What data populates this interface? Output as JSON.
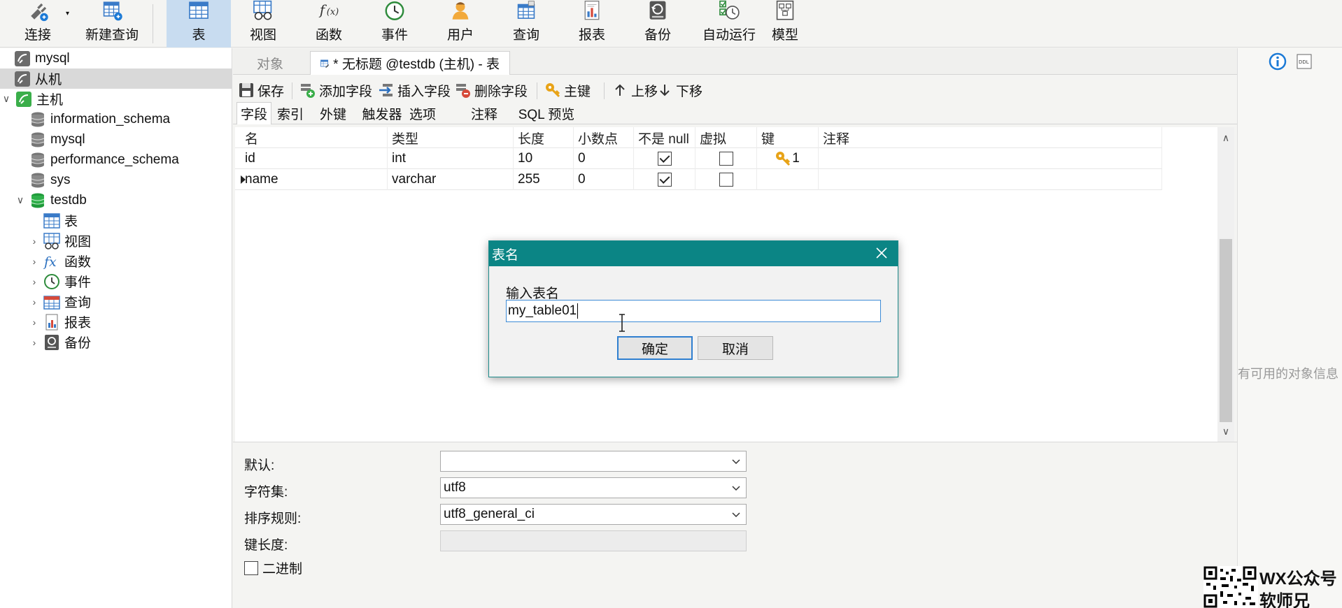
{
  "toolbar": {
    "items": [
      {
        "label": "连接",
        "icon": "plug-connect-icon"
      },
      {
        "label": "新建查询",
        "icon": "new-query-icon"
      },
      {
        "label": "表",
        "icon": "table-icon",
        "active": true
      },
      {
        "label": "视图",
        "icon": "view-glasses-icon"
      },
      {
        "label": "函数",
        "icon": "function-fx-icon"
      },
      {
        "label": "事件",
        "icon": "event-clock-icon"
      },
      {
        "label": "用户",
        "icon": "user-icon"
      },
      {
        "label": "查询",
        "icon": "query-icon"
      },
      {
        "label": "报表",
        "icon": "report-icon"
      },
      {
        "label": "备份",
        "icon": "backup-icon"
      },
      {
        "label": "自动运行",
        "icon": "auto-run-icon"
      },
      {
        "label": "模型",
        "icon": "model-icon"
      }
    ]
  },
  "tree": {
    "items": [
      {
        "label": "mysql",
        "level": 0,
        "icon": "connection-icon"
      },
      {
        "label": "从机",
        "level": 0,
        "icon": "connection-icon",
        "selected": true
      },
      {
        "label": "主机",
        "level": 0,
        "icon": "connection-open-icon",
        "expanded": true
      },
      {
        "label": "information_schema",
        "level": 1,
        "icon": "database-icon"
      },
      {
        "label": "mysql",
        "level": 1,
        "icon": "database-icon"
      },
      {
        "label": "performance_schema",
        "level": 1,
        "icon": "database-icon"
      },
      {
        "label": "sys",
        "level": 1,
        "icon": "database-icon"
      },
      {
        "label": "testdb",
        "level": 1,
        "icon": "database-open-icon",
        "expanded": true
      },
      {
        "label": "表",
        "level": 2,
        "icon": "table-icon"
      },
      {
        "label": "视图",
        "level": 2,
        "icon": "view-icon",
        "collapsed": true
      },
      {
        "label": "函数",
        "level": 2,
        "icon": "function-icon",
        "collapsed": true
      },
      {
        "label": "事件",
        "level": 2,
        "icon": "event-icon",
        "collapsed": true
      },
      {
        "label": "查询",
        "level": 2,
        "icon": "query-icon",
        "collapsed": true
      },
      {
        "label": "报表",
        "level": 2,
        "icon": "report-icon",
        "collapsed": true
      },
      {
        "label": "备份",
        "level": 2,
        "icon": "backup-icon",
        "collapsed": true
      }
    ]
  },
  "tabs": {
    "objects_label": "对象",
    "current_label": "* 无标题 @testdb (主机) - 表"
  },
  "edit_tools": {
    "save": "保存",
    "add_field": "添加字段",
    "insert_field": "插入字段",
    "delete_field": "删除字段",
    "primary_key": "主键",
    "move_up": "上移",
    "move_down": "下移"
  },
  "subtabs": [
    "字段",
    "索引",
    "外键",
    "触发器",
    "选项",
    "注释",
    "SQL 预览"
  ],
  "grid": {
    "columns": [
      "名",
      "类型",
      "长度",
      "小数点",
      "不是 null",
      "虚拟",
      "键",
      "注释"
    ],
    "rows": [
      {
        "name": "id",
        "type": "int",
        "length": "10",
        "decimals": "0",
        "not_null": true,
        "virtual": false,
        "key": "1",
        "comment": ""
      },
      {
        "name": "name",
        "type": "varchar",
        "length": "255",
        "decimals": "0",
        "not_null": true,
        "virtual": false,
        "key": "",
        "comment": "",
        "current": true
      }
    ]
  },
  "props": {
    "default_label": "默认:",
    "default_value": "",
    "charset_label": "字符集:",
    "charset_value": "utf8",
    "collation_label": "排序规则:",
    "collation_value": "utf8_general_ci",
    "keylen_label": "键长度:",
    "keylen_value": "",
    "binary_label": "二进制",
    "binary_checked": false
  },
  "right_panel": {
    "empty_text": "有可用的对象信息"
  },
  "dialog": {
    "title": "表名",
    "prompt": "输入表名",
    "value": "my_table01",
    "ok": "确定",
    "cancel": "取消"
  },
  "watermark": {
    "line1": "WX公众号",
    "line2": "软师兄"
  },
  "colors": {
    "dialog_title": "#0b8585",
    "selected_tab": "#c8dcf0",
    "focus_border": "#2f7fd0"
  }
}
